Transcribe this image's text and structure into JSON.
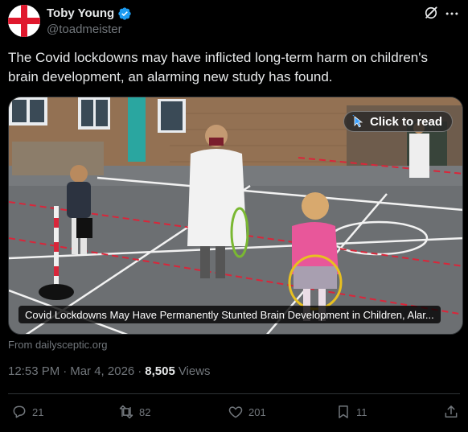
{
  "author": {
    "display_name": "Toby Young",
    "handle": "@toadmeister",
    "avatar_icon": "st-george-cross-flag",
    "verified": true,
    "verified_color": "#1d9bf0"
  },
  "header_icons": [
    "grok-icon",
    "more-icon"
  ],
  "tweet": {
    "text": "The Covid lockdowns may have inflicted long-term harm on children's brain development, an alarming new study has found."
  },
  "card": {
    "cta_label": "Click to read",
    "caption": "Covid Lockdowns May Have Permanently Stunted Brain Development in Children, Alar...",
    "source": "From dailysceptic.org"
  },
  "meta": {
    "time": "12:53 PM",
    "date": "Mar 4, 2026",
    "views_count": "8,505",
    "views_label": "Views",
    "separator": "·"
  },
  "actions": {
    "replies": "21",
    "reposts": "82",
    "likes": "201",
    "bookmarks": "11"
  },
  "colors": {
    "background": "#000000",
    "text": "#e7e9ea",
    "muted": "#71767b",
    "border": "#2f3336"
  }
}
